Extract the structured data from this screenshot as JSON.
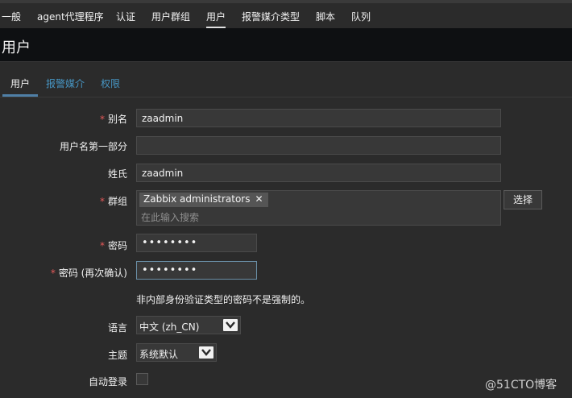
{
  "topnav": {
    "items": [
      "一般",
      "agent代理程序",
      "认证",
      "用户群组",
      "用户",
      "报警媒介类型",
      "脚本",
      "队列"
    ]
  },
  "page": {
    "title": "用户"
  },
  "tabs": [
    "用户",
    "报警媒介",
    "权限"
  ],
  "form": {
    "alias": {
      "label": "别名",
      "value": "zaadmin"
    },
    "name": {
      "label": "用户名第一部分",
      "value": ""
    },
    "surname": {
      "label": "姓氏",
      "value": "zaadmin"
    },
    "groups": {
      "label": "群组",
      "selected": [
        "Zabbix administrators"
      ],
      "placeholder": "在此输入搜索",
      "select_button": "选择"
    },
    "password": {
      "label": "密码",
      "value": "••••••••"
    },
    "password_confirm": {
      "label": "密码 (再次确认)",
      "value": "••••••••"
    },
    "password_note": "非内部身份验证类型的密码不是强制的。",
    "language": {
      "label": "语言",
      "value": "中文 (zh_CN)"
    },
    "theme": {
      "label": "主题",
      "value": "系统默认"
    },
    "autologin": {
      "label": "自动登录",
      "checked": false
    }
  },
  "watermark": "@51CTO博客",
  "colors": {
    "accent": "#4796c4",
    "required": "#e45959",
    "background": "#2b2b2b"
  }
}
